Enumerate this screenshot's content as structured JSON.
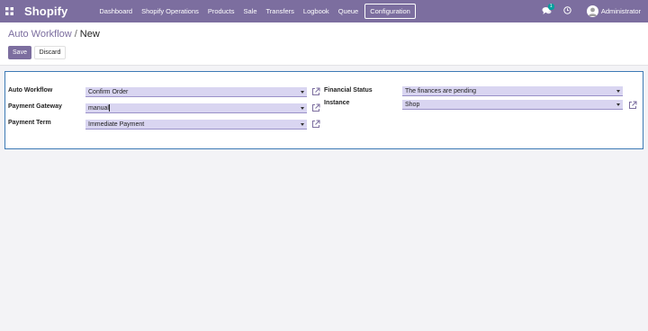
{
  "navbar": {
    "brand": "Shopify",
    "menu": [
      {
        "label": "Dashboard"
      },
      {
        "label": "Shopify Operations"
      },
      {
        "label": "Products"
      },
      {
        "label": "Sale"
      },
      {
        "label": "Transfers"
      },
      {
        "label": "Logbook"
      },
      {
        "label": "Queue"
      },
      {
        "label": "Configuration"
      }
    ],
    "active_menu": "Configuration",
    "messages_count": "1",
    "user_name": "Administrator"
  },
  "breadcrumb": {
    "parent": "Auto Workflow",
    "separator": "/",
    "current": "New"
  },
  "buttons": {
    "save": "Save",
    "discard": "Discard"
  },
  "form": {
    "auto_workflow": {
      "label": "Auto Workflow",
      "value": "Confirm Order"
    },
    "payment_gateway": {
      "label": "Payment Gateway",
      "value": "manual"
    },
    "payment_term": {
      "label": "Payment Term",
      "value": "Immediate Payment"
    },
    "financial_status": {
      "label": "Financial Status",
      "value": "The finances are pending"
    },
    "instance": {
      "label": "Instance",
      "value": "Shop"
    }
  },
  "colors": {
    "navbar": "#7c6e9f",
    "primary": "#7c6e9f",
    "field_bg": "#d9d5f1",
    "sheet_border": "#3d7ab5",
    "badge": "#00a09d"
  },
  "icons": [
    "apps-icon",
    "chat-icon",
    "clock-icon",
    "external-link-icon"
  ]
}
